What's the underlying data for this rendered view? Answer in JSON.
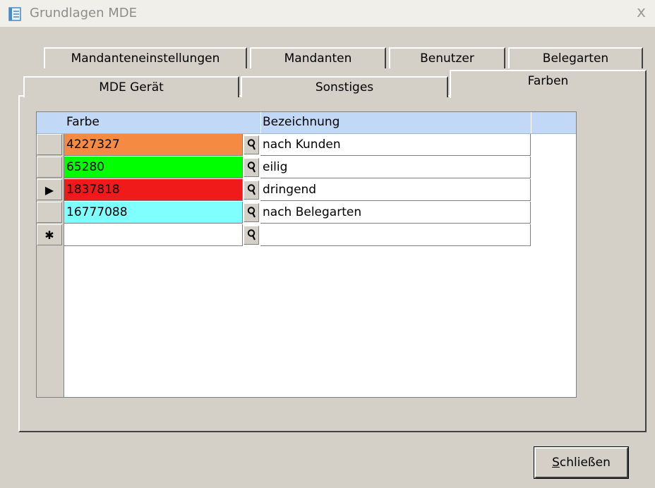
{
  "window": {
    "title": "Grundlagen MDE",
    "close_glyph": "x",
    "icon": "form-icon"
  },
  "tabs": {
    "row_back": [
      "Mandanteneinstellungen",
      "Mandanten",
      "Benutzer",
      "Belegarten"
    ],
    "row_front": [
      "MDE Gerät",
      "Sonstiges",
      "Farben"
    ],
    "active": "Farben"
  },
  "grid": {
    "headers": {
      "color": "Farbe",
      "description": "Bezeichnung"
    },
    "header_color": "#c1d8f7",
    "rows": [
      {
        "value": "4227327",
        "description": "nach Kunden",
        "bg": "#f58a43",
        "current": false
      },
      {
        "value": "65280",
        "description": "eilig",
        "bg": "#00ff00",
        "current": false
      },
      {
        "value": "1837818",
        "description": "dringend",
        "bg": "#f01a1a",
        "current": true
      },
      {
        "value": "16777088",
        "description": "nach Belegarten",
        "bg": "#80ffff",
        "current": false
      }
    ],
    "current_row_glyph": "▶",
    "new_row_glyph": "✱",
    "lookup_icon": "magnifier-icon"
  },
  "buttons": {
    "close_mnemonic": "S",
    "close_rest": "chließen"
  }
}
